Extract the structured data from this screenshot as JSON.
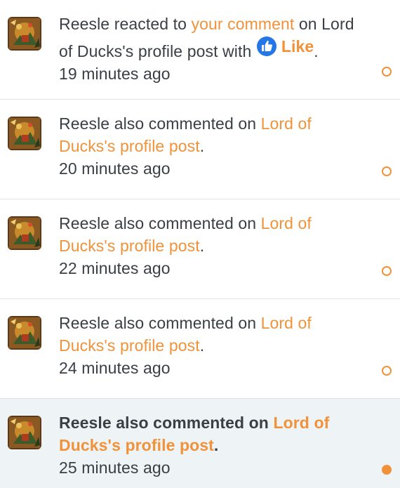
{
  "notifications": [
    {
      "user": "Reesle",
      "action": " reacted to ",
      "link": "your comment",
      "mid": " on Lord of Ducks's profile post with ",
      "reaction": "Like",
      "end": ".",
      "time": "19 minutes ago",
      "unread": false
    },
    {
      "user": "Reesle",
      "action": " also commented on ",
      "link": "Lord of Ducks's profile post",
      "end": ".",
      "time": "20 minutes ago",
      "unread": false
    },
    {
      "user": "Reesle",
      "action": " also commented on ",
      "link": "Lord of Ducks's profile post",
      "end": ".",
      "time": "22 minutes ago",
      "unread": false
    },
    {
      "user": "Reesle",
      "action": " also commented on ",
      "link": "Lord of Ducks's profile post",
      "end": ".",
      "time": "24 minutes ago",
      "unread": false
    },
    {
      "user": "Reesle",
      "action": " also commented on ",
      "link": "Lord of Ducks's profile post",
      "end": ".",
      "time": "25 minutes ago",
      "unread": true
    }
  ],
  "colors": {
    "accent": "#f0923a",
    "text": "#3a3f45",
    "unread_bg": "#eef3f6",
    "like_blue": "#2577e8"
  },
  "icons": {
    "avatar": "user-avatar-image",
    "reaction": "thumbs-up-icon",
    "read_marker": "circle-outline-icon",
    "unread_marker": "circle-filled-icon"
  }
}
